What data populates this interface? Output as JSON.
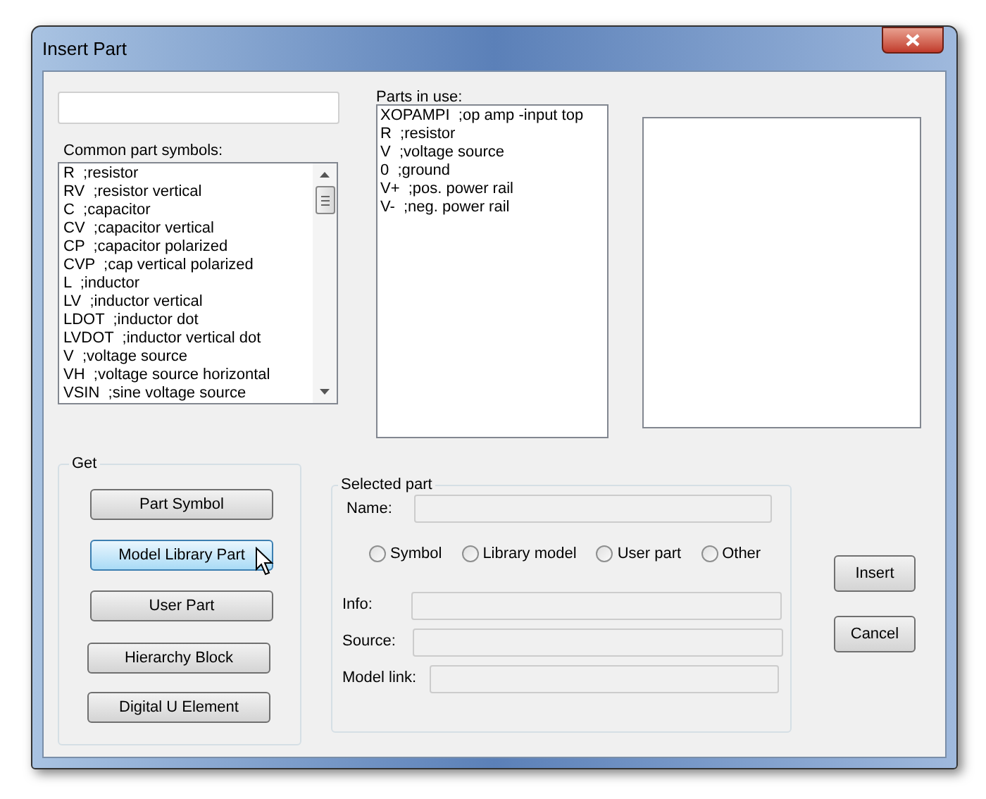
{
  "window": {
    "title": "Insert Part"
  },
  "common_parts": {
    "label": "Common part symbols:",
    "items": [
      "R  ;resistor",
      "RV  ;resistor vertical",
      "C  ;capacitor",
      "CV  ;capacitor vertical",
      "CP  ;capacitor polarized",
      "CVP  ;cap vertical polarized",
      "L  ;inductor",
      "LV  ;inductor vertical",
      "LDOT  ;inductor dot",
      "LVDOT  ;inductor vertical dot",
      "V  ;voltage source",
      "VH  ;voltage source horizontal",
      "VSIN  ;sine voltage source"
    ]
  },
  "parts_in_use": {
    "label": "Parts in use:",
    "items": [
      "XOPAMPI  ;op amp -input top",
      "R  ;resistor",
      "V  ;voltage source",
      "0  ;ground",
      "V+  ;pos. power rail",
      "V-  ;neg. power rail"
    ]
  },
  "get_group": {
    "label": "Get",
    "buttons": [
      {
        "label": "Part Symbol",
        "hovered": false
      },
      {
        "label": "Model Library Part",
        "hovered": true
      },
      {
        "label": "User Part",
        "hovered": false
      },
      {
        "label": "Hierarchy Block",
        "hovered": false
      },
      {
        "label": "Digital U Element",
        "hovered": false
      }
    ]
  },
  "selected_part": {
    "label": "Selected part",
    "name_label": "Name:",
    "types": [
      {
        "label": "Symbol",
        "selected": false
      },
      {
        "label": "Library model",
        "selected": false
      },
      {
        "label": "User part",
        "selected": false
      },
      {
        "label": "Other",
        "selected": false
      }
    ],
    "fields": [
      {
        "label": "Info:"
      },
      {
        "label": "Source:"
      },
      {
        "label": "Model link:"
      }
    ]
  },
  "actions": [
    "Insert",
    "Cancel"
  ]
}
